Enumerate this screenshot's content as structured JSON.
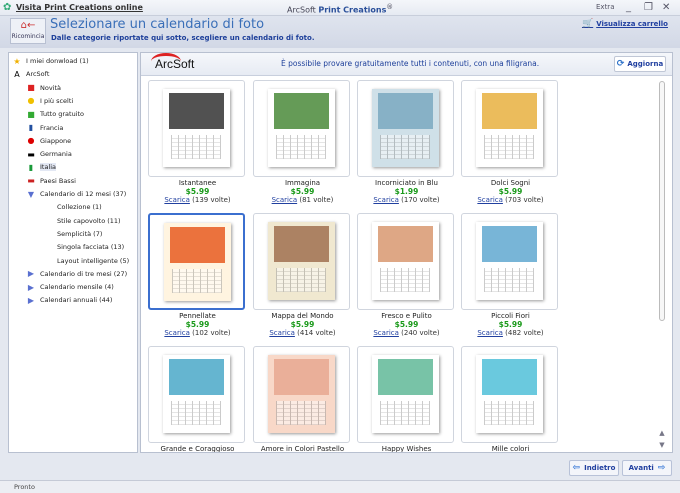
{
  "titlebar": {
    "link": "Visita Print Creations online",
    "app_prefix": "ArcSoft",
    "app_name": "Print Creations",
    "extra": "Extra",
    "minimize": "_",
    "restore": "❐",
    "close": "✕"
  },
  "header": {
    "restart_label": "Ricomincia",
    "title": "Selezionare un calendario di foto",
    "subtitle": "Dalle categorie riportate qui sotto, scegliere un calendario di foto.",
    "cart_label": "Visualizza carrello"
  },
  "tree": [
    {
      "label": "I miei donwload (1)",
      "icon": "star-icon",
      "level": 0
    },
    {
      "label": "ArcSoft",
      "icon": "arcsoft-icon",
      "level": 0
    },
    {
      "label": "Novità",
      "icon": "new-badge-icon",
      "level": 1
    },
    {
      "label": "I più scelti",
      "icon": "hot-badge-icon",
      "level": 1
    },
    {
      "label": "Tutto gratuito",
      "icon": "free-badge-icon",
      "level": 1
    },
    {
      "label": "Francia",
      "icon": "flag-france-icon",
      "level": 1
    },
    {
      "label": "Giappone",
      "icon": "flag-japan-icon",
      "level": 1
    },
    {
      "label": "Germania",
      "icon": "flag-germany-icon",
      "level": 1
    },
    {
      "label": "Italia",
      "icon": "flag-italy-icon",
      "level": 1,
      "selected": true
    },
    {
      "label": "Paesi Bassi",
      "icon": "flag-netherlands-icon",
      "level": 1
    },
    {
      "label": "Calendario di 12 mesi (37)",
      "icon": "expanded-arrow-icon",
      "level": 1
    },
    {
      "label": "Collezione (1)",
      "level": 2
    },
    {
      "label": "Stile capovolto (11)",
      "level": 2
    },
    {
      "label": "Semplicità (7)",
      "level": 2
    },
    {
      "label": "Singola facciata (13)",
      "level": 2
    },
    {
      "label": "Layout intelligente (5)",
      "level": 2
    },
    {
      "label": "Calendario di tre mesi (27)",
      "icon": "collapsed-arrow-icon",
      "level": 1
    },
    {
      "label": "Calendario mensile (4)",
      "icon": "collapsed-arrow-icon",
      "level": 1
    },
    {
      "label": "Calendari annuali (44)",
      "icon": "collapsed-arrow-icon",
      "level": 1
    }
  ],
  "main": {
    "logo": "ArcSoft",
    "notice": "È possibile provare gratuitamente tutti i contenuti, con una filigrana.",
    "refresh_label": "Aggiorna",
    "download_link": "Scarica",
    "items": [
      {
        "name": "Istantanee",
        "price": "$5.99",
        "downloads": "(139 volte)",
        "colors": [
          "#ffffff",
          "#333333"
        ]
      },
      {
        "name": "Immagina",
        "price": "$5.99",
        "downloads": "(81 volte)",
        "colors": [
          "#ffffff",
          "#4a8a3a"
        ]
      },
      {
        "name": "Incorniciato in Blu",
        "price": "$1.99",
        "downloads": "(170 volte)",
        "colors": [
          "#cfe0e8",
          "#7aa8c0"
        ]
      },
      {
        "name": "Dolci Sogni",
        "price": "$5.99",
        "downloads": "(703 volte)",
        "colors": [
          "#ffffff",
          "#e8b040"
        ]
      },
      {
        "name": "Pennellate",
        "price": "$5.99",
        "downloads": "(102 volte)",
        "colors": [
          "#fff4e0",
          "#e85a20"
        ]
      },
      {
        "name": "Mappa del Mondo",
        "price": "$5.99",
        "downloads": "(414 volte)",
        "colors": [
          "#f0e8d0",
          "#a07050"
        ]
      },
      {
        "name": "Fresco e Pulito",
        "price": "$5.99",
        "downloads": "(240 volte)",
        "colors": [
          "#ffffff",
          "#d89870"
        ]
      },
      {
        "name": "Piccoli Fiori",
        "price": "$5.99",
        "downloads": "(482 volte)",
        "colors": [
          "#ffffff",
          "#60a8d0"
        ]
      },
      {
        "name": "Grande e Coraggioso",
        "colors": [
          "#ffffff",
          "#4aa8c8"
        ]
      },
      {
        "name": "Amore in Colori Pastello",
        "colors": [
          "#f8d8c8",
          "#e8a890"
        ]
      },
      {
        "name": "Happy Wishes",
        "colors": [
          "#ffffff",
          "#60b898"
        ]
      },
      {
        "name": "Mille colori",
        "colors": [
          "#ffffff",
          "#50c0d8"
        ]
      }
    ]
  },
  "nav": {
    "back_label": "Indietro",
    "next_label": "Avanti"
  },
  "status": "Pronto"
}
